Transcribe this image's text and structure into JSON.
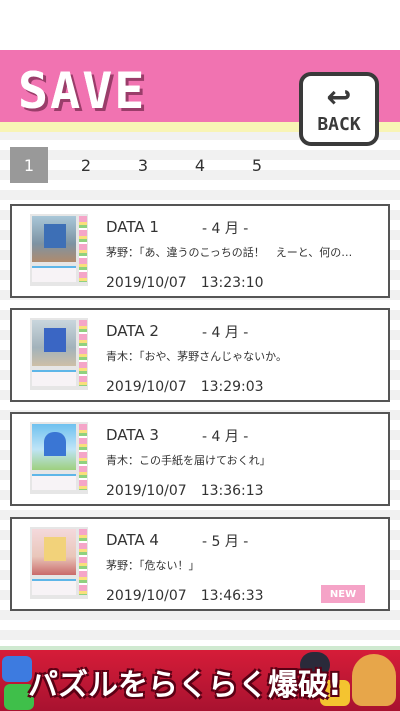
{
  "header": {
    "title": "SAVE",
    "back_label": "BACK",
    "back_icon": "return-arrow-icon",
    "colors": {
      "header_bg": "#f173b1",
      "strip": "#f8f4b5"
    }
  },
  "pagination": {
    "pages": [
      "1",
      "2",
      "3",
      "4",
      "5"
    ],
    "active": "1"
  },
  "slots": [
    {
      "name": "DATA 1",
      "month": "- 4 月 -",
      "line": "茅野：「あ、違うのこっちの話！　えーと、何の…",
      "date": "2019/10/07　13:23:10",
      "is_new": false
    },
    {
      "name": "DATA 2",
      "month": "- 4 月 -",
      "line": "青木：「おや、茅野さんじゃないか。",
      "date": "2019/10/07　13:29:03",
      "is_new": false
    },
    {
      "name": "DATA 3",
      "month": "- 4 月 -",
      "line": "青木：この手紙を届けておくれ」",
      "date": "2019/10/07　13:36:13",
      "is_new": false
    },
    {
      "name": "DATA 4",
      "month": "- 5 月 -",
      "line": "茅野：「危ない！」",
      "date": "2019/10/07　13:46:33",
      "is_new": true,
      "badge": "NEW"
    }
  ],
  "ad": {
    "text": "パズルをらくらく爆破!"
  }
}
